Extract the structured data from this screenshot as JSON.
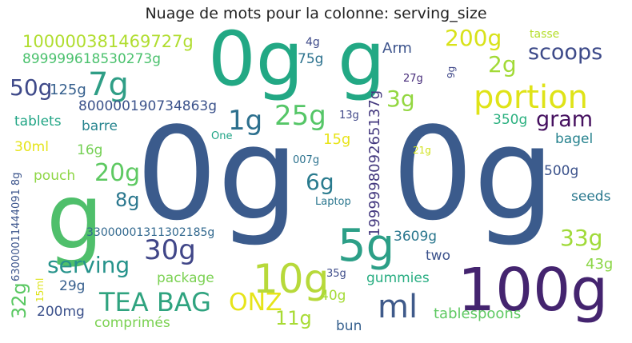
{
  "title": "Nuage de mots pour la colonne: serving_size",
  "words": [
    {
      "text": "0g",
      "color": "#3b5b8c"
    },
    {
      "text": "0g",
      "color": "#3b5b8c"
    },
    {
      "text": "g",
      "color": "#4fbf6b"
    },
    {
      "text": "0g",
      "color": "#22a884"
    },
    {
      "text": "g",
      "color": "#22a884"
    },
    {
      "text": "100g",
      "color": "#44246f"
    },
    {
      "text": "5g",
      "color": "#2c9f87"
    },
    {
      "text": "10g",
      "color": "#b7d93a"
    },
    {
      "text": "ml",
      "color": "#3f5a8a"
    },
    {
      "text": "TEA BAG",
      "color": "#2fa37f"
    },
    {
      "text": "ONZ",
      "color": "#e6e419"
    },
    {
      "text": "portion",
      "color": "#dfe318"
    },
    {
      "text": "7g",
      "color": "#2f9e86"
    },
    {
      "text": "scoops",
      "color": "#3d4a89"
    },
    {
      "text": "gram",
      "color": "#45105f"
    },
    {
      "text": "25g",
      "color": "#55c667"
    },
    {
      "text": "30g",
      "color": "#404688"
    },
    {
      "text": "20g",
      "color": "#5ec962"
    },
    {
      "text": "serving",
      "color": "#26938b"
    },
    {
      "text": "200g",
      "color": "#d8e219"
    },
    {
      "text": "1g",
      "color": "#2d708e"
    },
    {
      "text": "33g",
      "color": "#a0da39"
    },
    {
      "text": "3g",
      "color": "#93d741"
    },
    {
      "text": "2g",
      "color": "#a2da37"
    },
    {
      "text": "6g",
      "color": "#2a7b8e"
    },
    {
      "text": "50g",
      "color": "#3e4989"
    },
    {
      "text": "11g",
      "color": "#a8db34"
    },
    {
      "text": "32g",
      "color": "#5bc863"
    },
    {
      "text": "8g",
      "color": "#2a778e"
    },
    {
      "text": "100000381469727g",
      "color": "#b0dd2f"
    },
    {
      "text": "899999618530273g",
      "color": "#4ac16d"
    },
    {
      "text": "800000190734863g",
      "color": "#3b528b"
    },
    {
      "text": "199999809265137g",
      "color": "#44397f"
    },
    {
      "text": "33000001311302185g",
      "color": "#31688e"
    },
    {
      "text": "63000011444091 8g",
      "color": "#3a538b"
    },
    {
      "text": "Arm",
      "color": "#3b528b"
    },
    {
      "text": "75g",
      "color": "#2c728e"
    },
    {
      "text": "4g",
      "color": "#3e4a89"
    },
    {
      "text": "9g",
      "color": "#3f4788"
    },
    {
      "text": "27g",
      "color": "#472c7a"
    },
    {
      "text": "tasse",
      "color": "#b5de2b"
    },
    {
      "text": "125g",
      "color": "#355f8d"
    },
    {
      "text": "tablets",
      "color": "#21a585"
    },
    {
      "text": "barre",
      "color": "#25848e"
    },
    {
      "text": "30ml",
      "color": "#e5e419"
    },
    {
      "text": "16g",
      "color": "#75d054"
    },
    {
      "text": "pouch",
      "color": "#8ed645"
    },
    {
      "text": "13g",
      "color": "#3f4788"
    },
    {
      "text": "One",
      "color": "#20a486"
    },
    {
      "text": "15g",
      "color": "#e8e419"
    },
    {
      "text": "007g",
      "color": "#2c728e"
    },
    {
      "text": "21g",
      "color": "#d0e11c"
    },
    {
      "text": "350g",
      "color": "#2ab07f"
    },
    {
      "text": "bagel",
      "color": "#26828e"
    },
    {
      "text": "500g",
      "color": "#3b528b"
    },
    {
      "text": "seeds",
      "color": "#2a788e"
    },
    {
      "text": "Laptop",
      "color": "#2a768e"
    },
    {
      "text": "3609g",
      "color": "#2a778e"
    },
    {
      "text": "two",
      "color": "#3b518b"
    },
    {
      "text": "43g",
      "color": "#8bd646"
    },
    {
      "text": "package",
      "color": "#7ad151"
    },
    {
      "text": "35g",
      "color": "#3e4c8a"
    },
    {
      "text": "gummies",
      "color": "#27ad81"
    },
    {
      "text": "29g",
      "color": "#355e8d"
    },
    {
      "text": "40g",
      "color": "#a5db36"
    },
    {
      "text": "200mg",
      "color": "#3b518b"
    },
    {
      "text": "comprimés",
      "color": "#7ad151"
    },
    {
      "text": "tablespoons",
      "color": "#5ec962"
    },
    {
      "text": "bun",
      "color": "#355f8d"
    },
    {
      "text": "15ml",
      "color": "#dde318"
    }
  ]
}
